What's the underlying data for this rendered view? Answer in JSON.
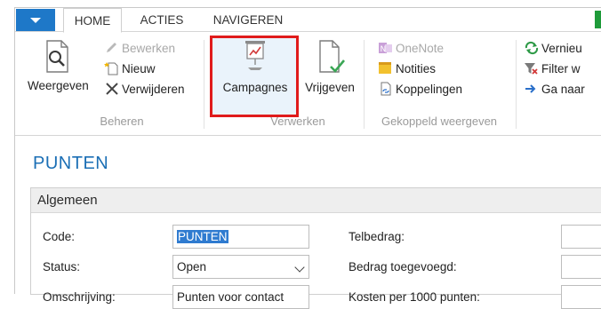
{
  "tabs": {
    "home": "HOME",
    "acties": "ACTIES",
    "navigeren": "NAVIGEREN"
  },
  "ribbon": {
    "beheren": {
      "label": "Beheren",
      "weergeven": "Weergeven",
      "bewerken": "Bewerken",
      "nieuw": "Nieuw",
      "verwijderen": "Verwijderen"
    },
    "verwerken": {
      "label": "Verwerken",
      "campagnes": "Campagnes",
      "vrijgeven": "Vrijgeven"
    },
    "gekoppeld": {
      "label": "Gekoppeld weergeven",
      "onenote": "OneNote",
      "notities": "Notities",
      "koppelingen": "Koppelingen"
    },
    "pagina": {
      "vernieuwen": "Vernieu",
      "filter": "Filter w",
      "ganaar": "Ga naar"
    }
  },
  "page": {
    "title": "PUNTEN",
    "section": "Algemeen",
    "code_label": "Code:",
    "code_value": "PUNTEN",
    "status_label": "Status:",
    "status_value": "Open",
    "third_label": "Omschrijving:",
    "third_value": "Punten voor contact",
    "telbedrag_label": "Telbedrag:",
    "bedrag_label": "Bedrag toegevoegd:",
    "kosten_label": "Kosten per 1000 punten:"
  },
  "colors": {
    "accent": "#1e78c8",
    "title_blue": "#1b6fb5",
    "highlight_red": "#e01b1b",
    "selection": "#2f7bd0"
  }
}
